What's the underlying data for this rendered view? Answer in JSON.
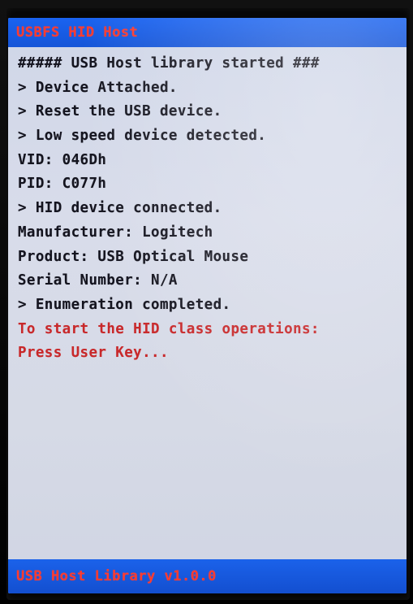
{
  "title_bar": {
    "label": "USBFS HID Host"
  },
  "log_lines": [
    {
      "text": "##### USB Host library started ###",
      "kind": "normal"
    },
    {
      "text": "> Device Attached.",
      "kind": "normal"
    },
    {
      "text": "> Reset the USB device.",
      "kind": "normal"
    },
    {
      "text": "> Low speed device detected.",
      "kind": "normal"
    },
    {
      "text": "VID: 046Dh",
      "kind": "normal"
    },
    {
      "text": "PID: C077h",
      "kind": "normal"
    },
    {
      "text": "> HID device connected.",
      "kind": "normal"
    },
    {
      "text": "Manufacturer: Logitech",
      "kind": "normal"
    },
    {
      "text": "Product: USB Optical Mouse",
      "kind": "normal"
    },
    {
      "text": "Serial Number: N/A",
      "kind": "normal"
    },
    {
      "text": "> Enumeration completed.",
      "kind": "normal"
    },
    {
      "text": "To start the HID class operations:",
      "kind": "prompt"
    },
    {
      "text": "Press User Key...",
      "kind": "prompt"
    }
  ],
  "footer_bar": {
    "label": "USB Host Library v1.0.0"
  },
  "colors": {
    "bar_blue": "#1a5fe6",
    "screen_background": "#d6dae6",
    "log_text": "#14141f",
    "prompt_text": "#c8282a",
    "bar_text": "#ff3b2f"
  }
}
